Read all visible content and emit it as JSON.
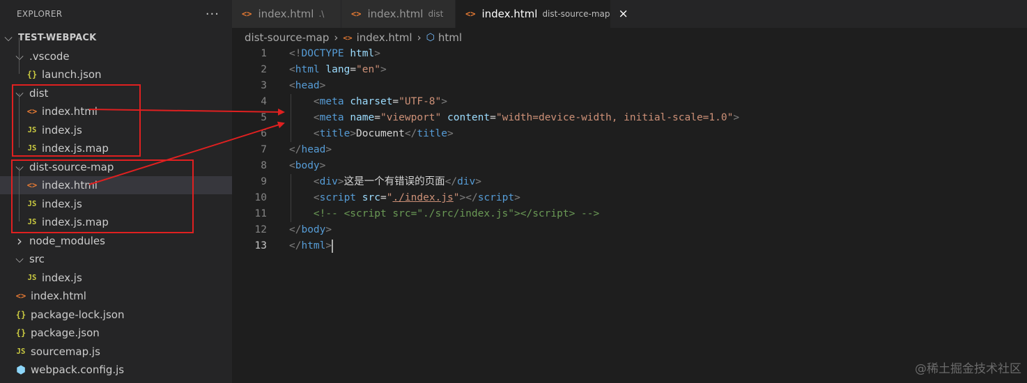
{
  "sidebar": {
    "title": "EXPLORER",
    "more_icon": "more-actions-icon",
    "root": "TEST-WEBPACK",
    "items": [
      {
        "label": ".vscode",
        "type": "folder",
        "open": true
      },
      {
        "label": "launch.json",
        "type": "json"
      },
      {
        "label": "dist",
        "type": "folder",
        "open": true
      },
      {
        "label": "index.html",
        "type": "html"
      },
      {
        "label": "index.js",
        "type": "js"
      },
      {
        "label": "index.js.map",
        "type": "js"
      },
      {
        "label": "dist-source-map",
        "type": "folder",
        "open": true
      },
      {
        "label": "index.html",
        "type": "html",
        "selected": true
      },
      {
        "label": "index.js",
        "type": "js"
      },
      {
        "label": "index.js.map",
        "type": "js"
      },
      {
        "label": "node_modules",
        "type": "folder",
        "open": false
      },
      {
        "label": "src",
        "type": "folder",
        "open": true
      },
      {
        "label": "index.js",
        "type": "js"
      },
      {
        "label": "index.html",
        "type": "html"
      },
      {
        "label": "package-lock.json",
        "type": "json"
      },
      {
        "label": "package.json",
        "type": "json"
      },
      {
        "label": "sourcemap.js",
        "type": "js"
      },
      {
        "label": "webpack.config.js",
        "type": "webpack"
      }
    ]
  },
  "tabs": [
    {
      "label": "index.html",
      "desc": ".\\",
      "active": false
    },
    {
      "label": "index.html",
      "desc": "dist",
      "active": false,
      "dirty": true
    },
    {
      "label": "index.html",
      "desc": "dist-source-map",
      "active": true
    }
  ],
  "icons": {
    "html": "<>",
    "js": "JS",
    "json": "{}",
    "close": "×",
    "chevron_open": "⌄",
    "chevron_closed": "›"
  },
  "breadcrumb": [
    "dist-source-map",
    "index.html",
    "html"
  ],
  "editor": {
    "line_numbers": [
      "1",
      "2",
      "3",
      "4",
      "5",
      "6",
      "7",
      "8",
      "9",
      "10",
      "11",
      "12",
      "13"
    ],
    "active_line": 13
  },
  "watermark": "@稀土掘金技术社区",
  "colors": {
    "annotation_red": "#e02020",
    "html_icon": "#e37933",
    "js_icon": "#cbcb41"
  }
}
